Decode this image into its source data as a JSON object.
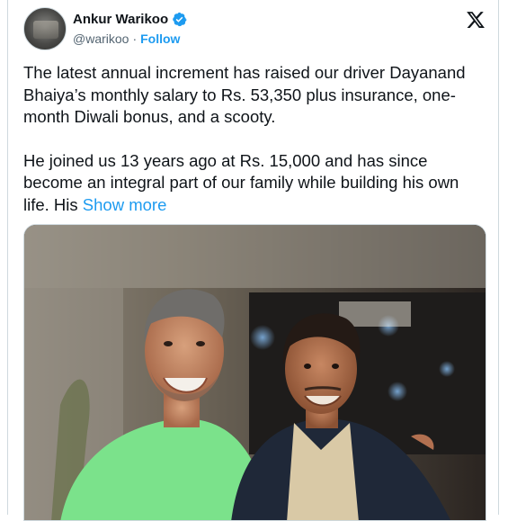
{
  "author": {
    "name": "Ankur Warikoo",
    "handle": "@warikoo",
    "follow_label": "Follow",
    "verified": true
  },
  "tweet": {
    "paragraph1": "The latest annual increment has raised our driver Dayanand Bhaiya’s monthly salary to Rs. 53,350 plus insurance, one-month Diwali bonus, and a scooty.",
    "paragraph2": "He joined us 13 years ago at Rs. 15,000 and has since become an integral part of our family while building his own life. His ",
    "show_more": "Show more"
  },
  "icons": {
    "verified": "verified-badge-icon",
    "platform": "x-logo-icon"
  },
  "colors": {
    "accent": "#1d9bf0",
    "text": "#0f1419",
    "muted": "#536471",
    "border": "#cfd9de"
  }
}
